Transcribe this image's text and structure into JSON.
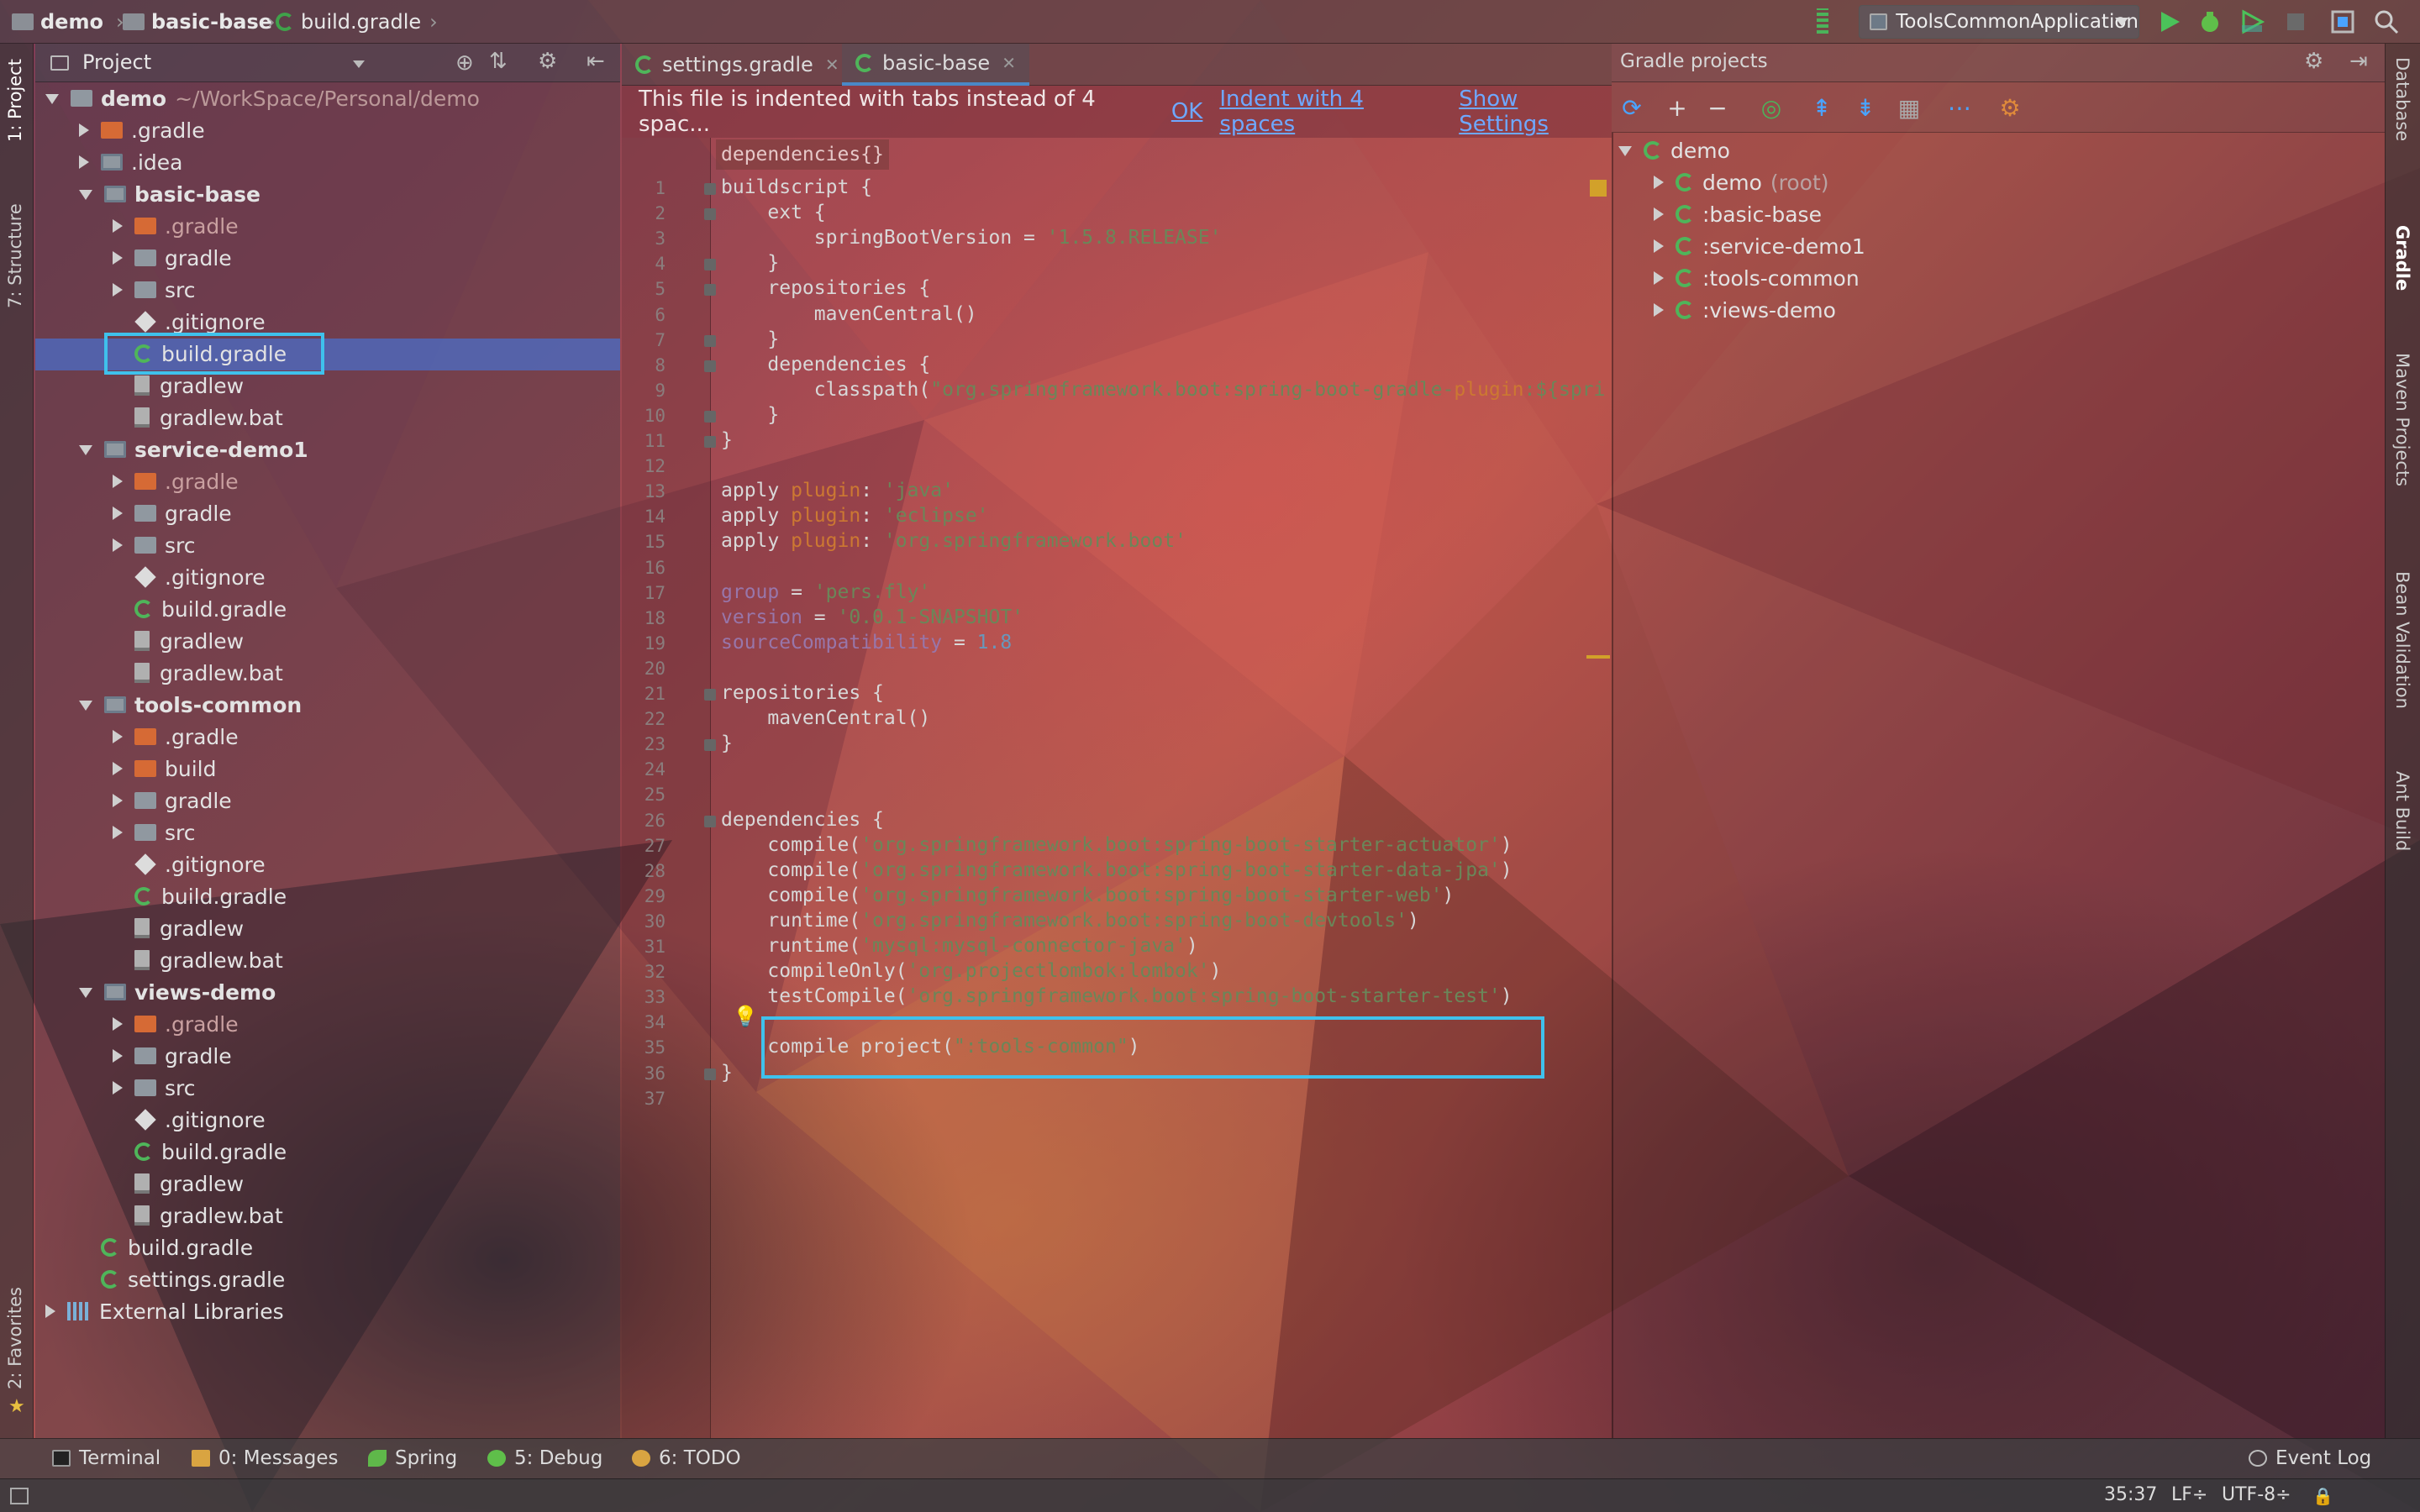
{
  "navbar": {
    "crumbs": [
      "demo",
      "basic-base",
      "build.gradle"
    ],
    "run_config": "ToolsCommonApplication"
  },
  "left_tabs": {
    "project": "1: Project",
    "structure": "7: Structure",
    "favorites": "2: Favorites"
  },
  "right_tabs": {
    "database": "Database",
    "gradle": "Gradle",
    "maven": "Maven Projects",
    "bean": "Bean Validation",
    "ant": "Ant Build"
  },
  "project_panel": {
    "title": "Project",
    "tree": [
      {
        "label": "demo",
        "suffix": "~/WorkSpace/Personal/demo"
      },
      {
        "label": ".gradle"
      },
      {
        "label": ".idea"
      },
      {
        "label": "basic-base"
      },
      {
        "label": ".gradle"
      },
      {
        "label": "gradle"
      },
      {
        "label": "src"
      },
      {
        "label": ".gitignore"
      },
      {
        "label": "build.gradle"
      },
      {
        "label": "gradlew"
      },
      {
        "label": "gradlew.bat"
      },
      {
        "label": "service-demo1"
      },
      {
        "label": ".gradle"
      },
      {
        "label": "gradle"
      },
      {
        "label": "src"
      },
      {
        "label": ".gitignore"
      },
      {
        "label": "build.gradle"
      },
      {
        "label": "gradlew"
      },
      {
        "label": "gradlew.bat"
      },
      {
        "label": "tools-common"
      },
      {
        "label": ".gradle"
      },
      {
        "label": "build"
      },
      {
        "label": "gradle"
      },
      {
        "label": "src"
      },
      {
        "label": ".gitignore"
      },
      {
        "label": "build.gradle"
      },
      {
        "label": "gradlew"
      },
      {
        "label": "gradlew.bat"
      },
      {
        "label": "views-demo"
      },
      {
        "label": ".gradle"
      },
      {
        "label": "gradle"
      },
      {
        "label": "src"
      },
      {
        "label": ".gitignore"
      },
      {
        "label": "build.gradle"
      },
      {
        "label": "gradlew"
      },
      {
        "label": "gradlew.bat"
      },
      {
        "label": "build.gradle"
      },
      {
        "label": "settings.gradle"
      },
      {
        "label": "External Libraries"
      }
    ]
  },
  "editor": {
    "tabs": [
      {
        "label": "settings.gradle"
      },
      {
        "label": "basic-base"
      }
    ],
    "banner": {
      "message": "This file is indented with tabs instead of 4 spac...",
      "ok": "OK",
      "indent": "Indent with 4 spaces",
      "settings": "Show Settings"
    },
    "breadcrumb": "dependencies{}",
    "lines": [
      "buildscript {",
      "    ext {",
      "        springBootVersion = '1.5.8.RELEASE'",
      "    }",
      "    repositories {",
      "        mavenCentral()",
      "    }",
      "    dependencies {",
      "        classpath(\"org.springframework.boot:spring-boot-gradle-plugin:${spri",
      "    }",
      "}",
      "",
      "apply plugin: 'java'",
      "apply plugin: 'eclipse'",
      "apply plugin: 'org.springframework.boot'",
      "",
      "group = 'pers.fly'",
      "version = '0.0.1-SNAPSHOT'",
      "sourceCompatibility = 1.8",
      "",
      "repositories {",
      "    mavenCentral()",
      "}",
      "",
      "",
      "dependencies {",
      "    compile('org.springframework.boot:spring-boot-starter-actuator')",
      "    compile('org.springframework.boot:spring-boot-starter-data-jpa')",
      "    compile('org.springframework.boot:spring-boot-starter-web')",
      "    runtime('org.springframework.boot:spring-boot-devtools')",
      "    runtime('mysql:mysql-connector-java')",
      "    compileOnly('org.projectlombok:lombok')",
      "    testCompile('org.springframework.boot:spring-boot-starter-test')",
      "",
      "    compile project(\":tools-common\")",
      "}",
      ""
    ]
  },
  "gradle_panel": {
    "title": "Gradle projects",
    "tree": [
      {
        "label": "demo"
      },
      {
        "label": "demo",
        "suffix": "(root)"
      },
      {
        "label": ":basic-base"
      },
      {
        "label": ":service-demo1"
      },
      {
        "label": ":tools-common"
      },
      {
        "label": ":views-demo"
      }
    ]
  },
  "bottom_tabs": {
    "terminal": "Terminal",
    "messages": "0: Messages",
    "spring": "Spring",
    "debug": "5: Debug",
    "todo": "6: TODO",
    "event_log": "Event Log"
  },
  "status": {
    "position": "35:37",
    "line_sep": "LF÷",
    "encoding": "UTF-8÷"
  }
}
